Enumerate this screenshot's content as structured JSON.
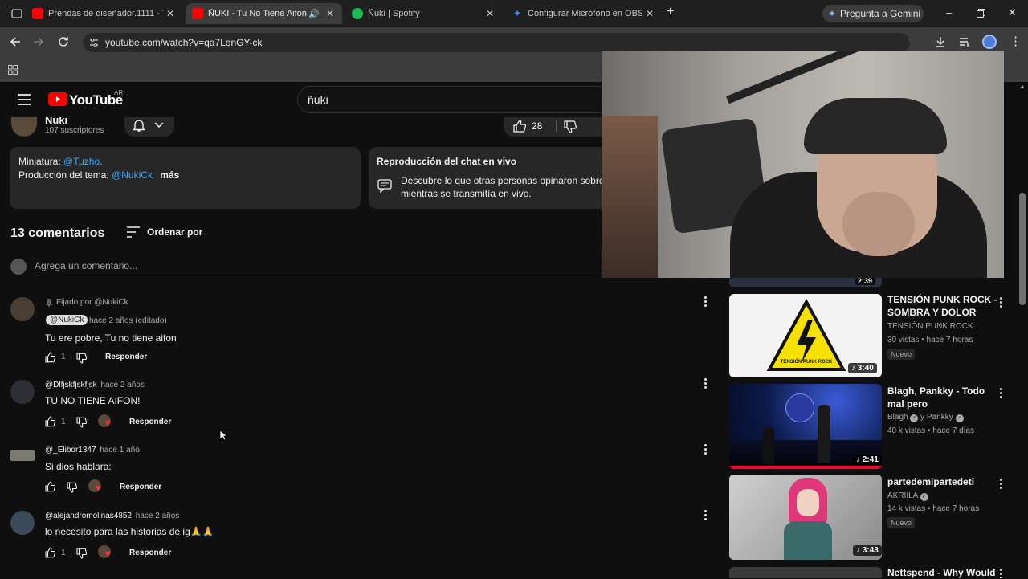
{
  "browser": {
    "tabs": [
      {
        "title": "Prendas de diseñador.1111 - Yo",
        "favicon_color": "#ff0000"
      },
      {
        "title": "ÑUKI - Tu No Tiene Aifon (",
        "favicon_color": "#ff0000"
      },
      {
        "title": "Ñuki | Spotify",
        "favicon_color": "#1db954"
      },
      {
        "title": "Configurar Micrófono en OBS S",
        "favicon_color": "#4285f4"
      }
    ],
    "gemini_label": "Pregunta a Gemini",
    "url": "youtube.com/watch?v=qa7LonGY-ck"
  },
  "youtube": {
    "logo_text": "YouTube",
    "country": "AR",
    "search_value": "ñuki",
    "channel_name": "Ñuki",
    "subscribers": "107 suscriptores",
    "likes": "28"
  },
  "description": {
    "line1_label": "Miniatura:",
    "line1_link": "@Tuzho.",
    "line2_label": "Producción del tema:",
    "line2_link": "@NukiCk",
    "more": "más"
  },
  "chat_replay": {
    "title": "Reproducción del chat en vivo",
    "text1": "Descubre lo que otras personas opinaron sobre",
    "text2": "mientras se transmitía en vivo."
  },
  "comments_header": {
    "count": "13 comentarios",
    "sort": "Ordenar por",
    "add_placeholder": "Agrega un comentario..."
  },
  "comments": [
    {
      "pinned": "Fijado por @NukiCk",
      "author": "@NukiCk",
      "time": "hace 2 años (editado)",
      "text": "Tu ere pobre, Tu no tiene aifon",
      "likes": "1",
      "reply": "Responder"
    },
    {
      "author": "@Dlfjskfjskfjsk",
      "time": "hace 2 años",
      "text": "TU NO TIENE AIFON!",
      "likes": "1",
      "reply": "Responder"
    },
    {
      "author": "@_Elibor1347",
      "time": "hace 1 año",
      "text": "Si dios hablara:",
      "likes": "",
      "reply": "Responder"
    },
    {
      "author": "@alejandromolinas4852",
      "time": "hace 2 años",
      "text": "lo necesito para las historias de ig🙏🙏",
      "likes": "1",
      "reply": "Responder"
    }
  ],
  "related": [
    {
      "title1": "TENSIÓN PUNK ROCK -",
      "title2": "SOMBRA Y DOLOR",
      "channel": "TENSIÓN PUNK ROCK",
      "stats": "30 vistas • hace 7 horas",
      "badge": "Nuevo",
      "duration": "3:40",
      "thumb_text": "TENSIÓN PUNK ROCK"
    },
    {
      "title1": "Blagh, Pankky - Todo",
      "title2": "mal pero",
      "channel": "Blagh",
      "channel2": "y Pankky",
      "stats": "40 k vistas • hace 7 días",
      "duration": "2:41"
    },
    {
      "title1": "partedemipartedeti",
      "title2": "",
      "channel": "AKRIILA",
      "stats": "14 k vistas • hace 7 horas",
      "badge": "Nuevo",
      "duration": "3:43"
    },
    {
      "title1": "Nettspend - Why Would",
      "prev_duration": "2:39"
    }
  ]
}
